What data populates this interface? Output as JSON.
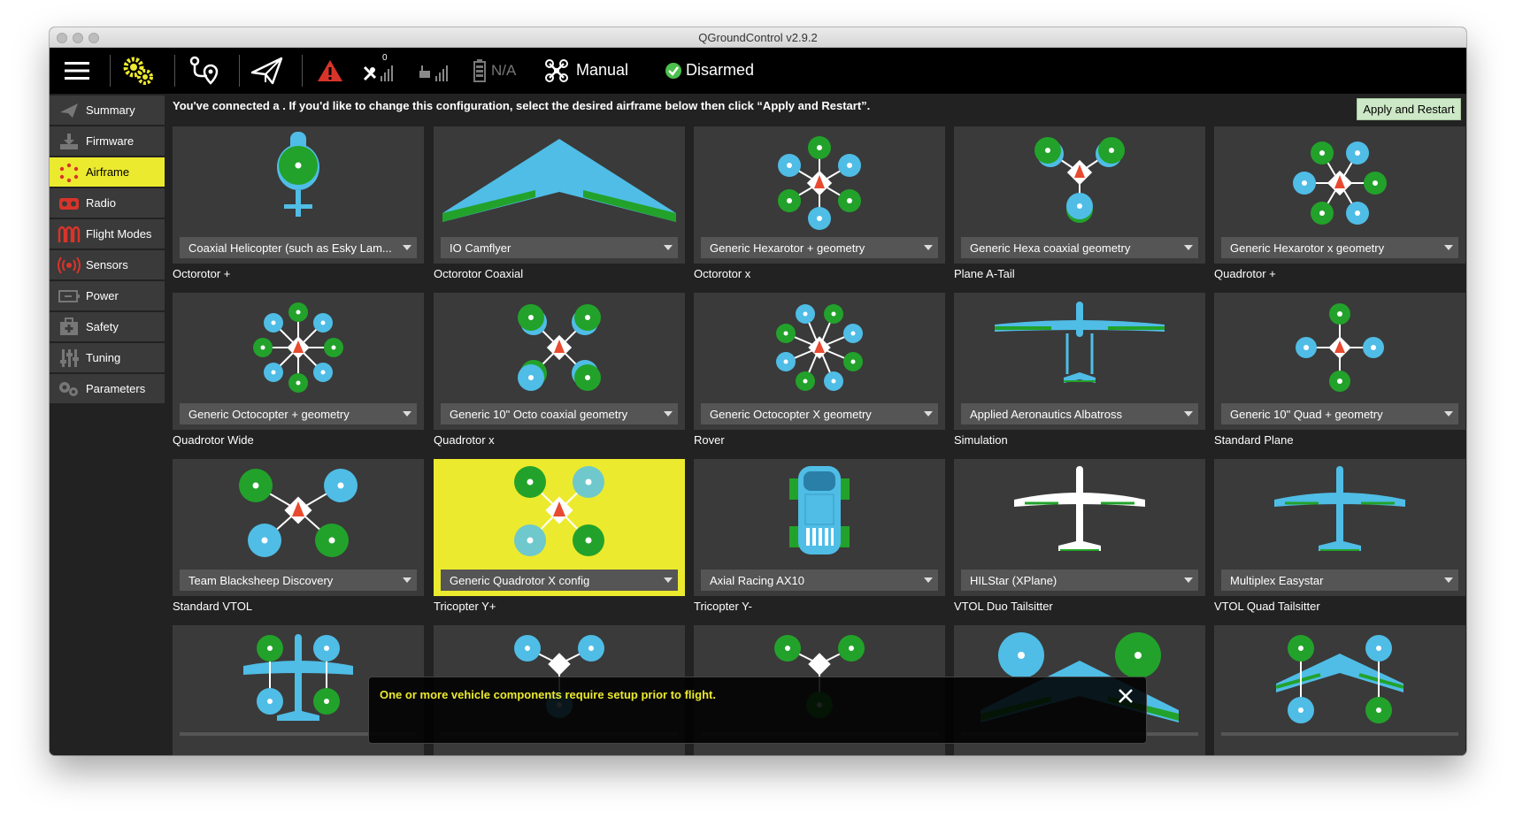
{
  "window": {
    "title": "QGroundControl v2.9.2"
  },
  "toolbar": {
    "satellite_count": "0",
    "battery_text": "N/A",
    "flight_mode": "Manual",
    "arm_status": "Disarmed"
  },
  "sidebar": {
    "items": [
      {
        "label": "Summary",
        "icon": "plane-icon"
      },
      {
        "label": "Firmware",
        "icon": "download-icon"
      },
      {
        "label": "Airframe",
        "icon": "airframe-icon",
        "active": true
      },
      {
        "label": "Radio",
        "icon": "radio-icon"
      },
      {
        "label": "Flight Modes",
        "icon": "waves-icon"
      },
      {
        "label": "Sensors",
        "icon": "sensors-icon"
      },
      {
        "label": "Power",
        "icon": "battery-icon"
      },
      {
        "label": "Safety",
        "icon": "medkit-icon"
      },
      {
        "label": "Tuning",
        "icon": "sliders-icon"
      },
      {
        "label": "Parameters",
        "icon": "gears-icon"
      }
    ]
  },
  "banner": {
    "text": "You've connected a . If you'd like to change this configuration, select the desired airframe below then click “Apply and Restart”."
  },
  "apply_button": {
    "label": "Apply and Restart"
  },
  "airframes": {
    "row1": [
      {
        "group": "",
        "selection": "Coaxial Helicopter (such as Esky Lam..."
      },
      {
        "group": "",
        "selection": "IO Camflyer"
      },
      {
        "group": "",
        "selection": "Generic Hexarotor + geometry"
      },
      {
        "group": "",
        "selection": "Generic Hexa coaxial geometry"
      },
      {
        "group": "",
        "selection": "Generic Hexarotor x geometry"
      }
    ],
    "row2": [
      {
        "group": "Octorotor +",
        "selection": "Generic Octocopter + geometry"
      },
      {
        "group": "Octorotor Coaxial",
        "selection": "Generic 10\" Octo coaxial geometry"
      },
      {
        "group": "Octorotor x",
        "selection": "Generic Octocopter X geometry"
      },
      {
        "group": "Plane A-Tail",
        "selection": "Applied Aeronautics Albatross"
      },
      {
        "group": "Quadrotor +",
        "selection": "Generic 10\" Quad + geometry"
      }
    ],
    "row3": [
      {
        "group": "Quadrotor Wide",
        "selection": "Team Blacksheep Discovery"
      },
      {
        "group": "Quadrotor x",
        "selection": "Generic Quadrotor X config",
        "selected": true
      },
      {
        "group": "Rover",
        "selection": "Axial Racing AX10"
      },
      {
        "group": "Simulation",
        "selection": "HILStar (XPlane)"
      },
      {
        "group": "Standard Plane",
        "selection": "Multiplex Easystar"
      }
    ],
    "row4": [
      {
        "group": "Standard VTOL"
      },
      {
        "group": "Tricopter Y+"
      },
      {
        "group": "Tricopter Y-"
      },
      {
        "group": "VTOL Duo Tailsitter"
      },
      {
        "group": "VTOL Quad Tailsitter"
      }
    ]
  },
  "popup": {
    "message": "One or more vehicle components require setup prior to flight."
  },
  "colors": {
    "accent": "#ecea2e",
    "motor_blue": "#4fbde6",
    "motor_green": "#22a22a",
    "panel": "#3a3a3a",
    "combo": "#555555",
    "arrow_red": "#e84a30"
  }
}
